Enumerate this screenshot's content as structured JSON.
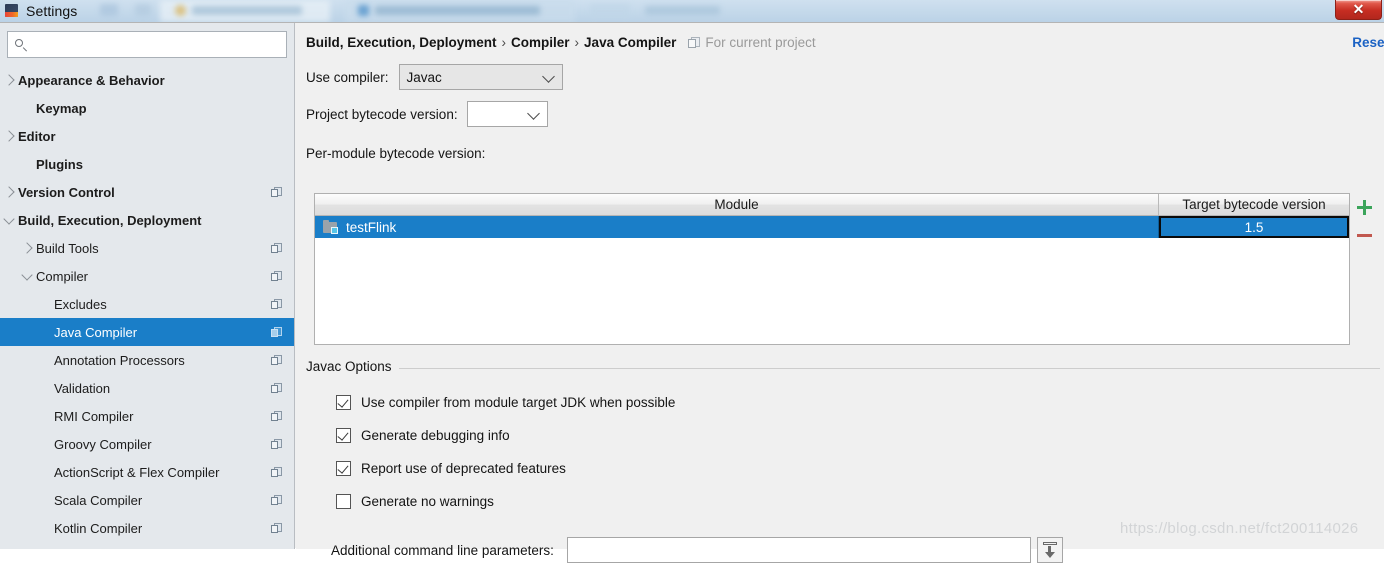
{
  "window": {
    "title": "Settings",
    "title_icon": "intellij-idea-icon",
    "close_label": "✕"
  },
  "sidebar": {
    "search": {
      "value": "",
      "placeholder": "",
      "icon": "search-icon"
    },
    "items": [
      {
        "label": "Appearance & Behavior",
        "arrow": "right",
        "bold": true,
        "indent": 8,
        "badge": false,
        "selected": false
      },
      {
        "label": "Keymap",
        "arrow": "none",
        "bold": true,
        "indent": 26,
        "badge": false,
        "selected": false
      },
      {
        "label": "Editor",
        "arrow": "right",
        "bold": true,
        "indent": 8,
        "badge": false,
        "selected": false
      },
      {
        "label": "Plugins",
        "arrow": "none",
        "bold": true,
        "indent": 26,
        "badge": false,
        "selected": false
      },
      {
        "label": "Version Control",
        "arrow": "right",
        "bold": true,
        "indent": 8,
        "badge": true,
        "selected": false
      },
      {
        "label": "Build, Execution, Deployment",
        "arrow": "down",
        "bold": true,
        "indent": 8,
        "badge": false,
        "selected": false
      },
      {
        "label": "Build Tools",
        "arrow": "right",
        "bold": false,
        "indent": 26,
        "badge": true,
        "selected": false
      },
      {
        "label": "Compiler",
        "arrow": "down",
        "bold": false,
        "indent": 26,
        "badge": true,
        "selected": false
      },
      {
        "label": "Excludes",
        "arrow": "none",
        "bold": false,
        "indent": 44,
        "badge": true,
        "selected": false
      },
      {
        "label": "Java Compiler",
        "arrow": "none",
        "bold": false,
        "indent": 44,
        "badge": true,
        "selected": true
      },
      {
        "label": "Annotation Processors",
        "arrow": "none",
        "bold": false,
        "indent": 44,
        "badge": true,
        "selected": false
      },
      {
        "label": "Validation",
        "arrow": "none",
        "bold": false,
        "indent": 44,
        "badge": true,
        "selected": false
      },
      {
        "label": "RMI Compiler",
        "arrow": "none",
        "bold": false,
        "indent": 44,
        "badge": true,
        "selected": false
      },
      {
        "label": "Groovy Compiler",
        "arrow": "none",
        "bold": false,
        "indent": 44,
        "badge": true,
        "selected": false
      },
      {
        "label": "ActionScript & Flex Compiler",
        "arrow": "none",
        "bold": false,
        "indent": 44,
        "badge": true,
        "selected": false
      },
      {
        "label": "Scala Compiler",
        "arrow": "none",
        "bold": false,
        "indent": 44,
        "badge": true,
        "selected": false
      },
      {
        "label": "Kotlin Compiler",
        "arrow": "none",
        "bold": false,
        "indent": 44,
        "badge": true,
        "selected": false
      }
    ]
  },
  "main": {
    "breadcrumb": {
      "segments": [
        "Build, Execution, Deployment",
        "Compiler",
        "Java Compiler"
      ],
      "separator": "›",
      "scope_label": "For current project",
      "scope_icon": "project-scope-icon"
    },
    "reset_label": "Reset",
    "use_compiler": {
      "label": "Use compiler:",
      "value": "Javac"
    },
    "project_bytecode": {
      "label": "Project bytecode version:",
      "value": ""
    },
    "per_module_label": "Per-module bytecode version:",
    "table": {
      "columns": [
        "Module",
        "Target bytecode version"
      ],
      "rows": [
        {
          "module": "testFlink",
          "target": "1.5",
          "icon": "module-icon",
          "selected": true
        }
      ],
      "add_button": "add-icon",
      "remove_button": "remove-icon"
    },
    "javac_options": {
      "title": "Javac Options",
      "checkboxes": [
        {
          "label": "Use compiler from module target JDK when possible",
          "checked": true
        },
        {
          "label": "Generate debugging info",
          "checked": true
        },
        {
          "label": "Report use of deprecated features",
          "checked": true
        },
        {
          "label": "Generate no warnings",
          "checked": false
        }
      ],
      "additional_params": {
        "label": "Additional command line parameters:",
        "value": "",
        "expand_icon": "expand-editor-icon"
      }
    }
  },
  "watermark": "https://blog.csdn.net/fct200114026",
  "colors": {
    "selection_blue": "#1a7ec8",
    "link_blue": "#1b62c4",
    "sidebar_bg": "#e4e8ec",
    "panel_bg": "#f0f0f0",
    "add_green": "#3ba45a",
    "remove_red": "#c1584f"
  }
}
